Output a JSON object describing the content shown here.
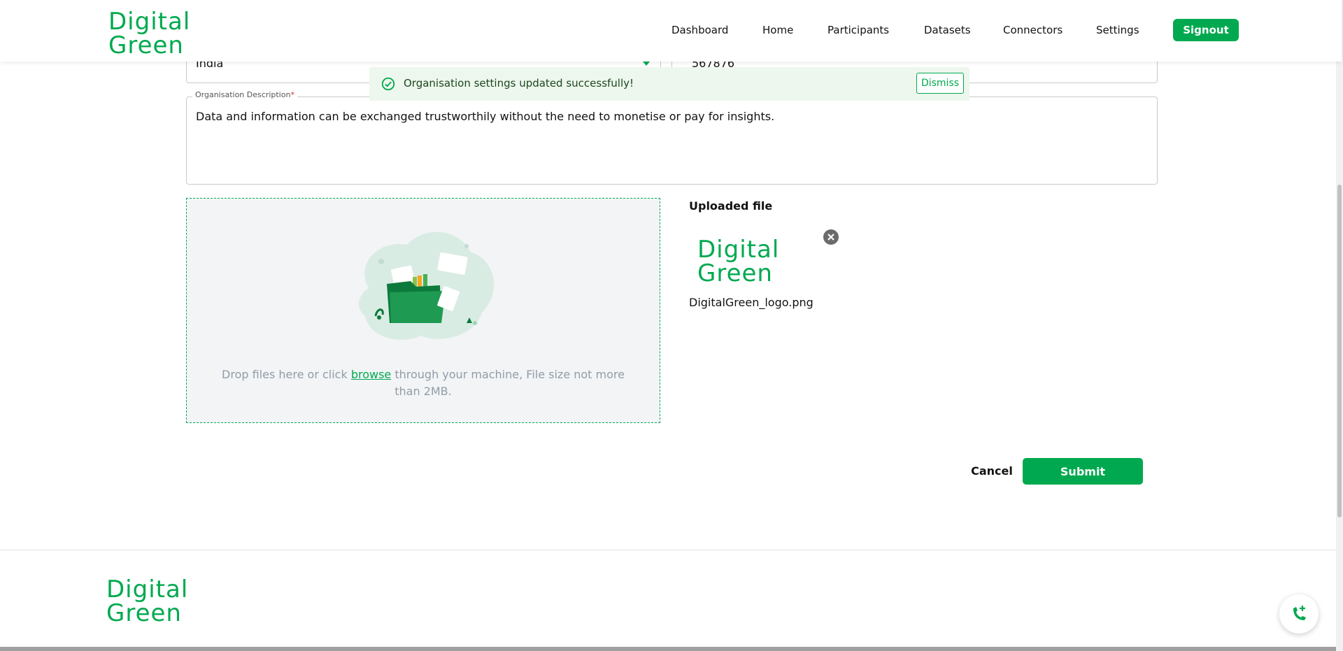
{
  "brand": {
    "line1": "Digital",
    "line2": "Green",
    "color": "#00a94f"
  },
  "nav": {
    "items": [
      {
        "label": "Dashboard"
      },
      {
        "label": "Home"
      },
      {
        "label": "Participants"
      },
      {
        "label": "Datasets"
      },
      {
        "label": "Connectors"
      },
      {
        "label": "Settings"
      }
    ],
    "signout_label": "Signout"
  },
  "form": {
    "country_value": "India",
    "pincode_value": "567876",
    "description": {
      "label": "Organisation Description",
      "required_mark": "*",
      "value": "Data and information can be exchanged trustworthily without the need to monetise or pay for insights."
    },
    "dropzone": {
      "text_before": "Drop files here or click ",
      "link_label": "browse",
      "text_after": " through your machine, File size not more than 2MB."
    },
    "uploaded": {
      "title": "Uploaded file",
      "file_name": "DigitalGreen_logo.png"
    },
    "cancel_label": "Cancel",
    "submit_label": "Submit"
  },
  "toast": {
    "message": "Organisation settings updated successfully!",
    "dismiss_label": "Dismiss"
  },
  "icons": {
    "toast": "check-circle-icon",
    "remove": "close-circle-icon",
    "dropdown": "chevron-down-icon",
    "support": "phone-add-icon"
  },
  "colors": {
    "accent": "#00a94f",
    "toast_bg": "#edf7ed",
    "dropzone_bg": "#f2f4f6"
  }
}
